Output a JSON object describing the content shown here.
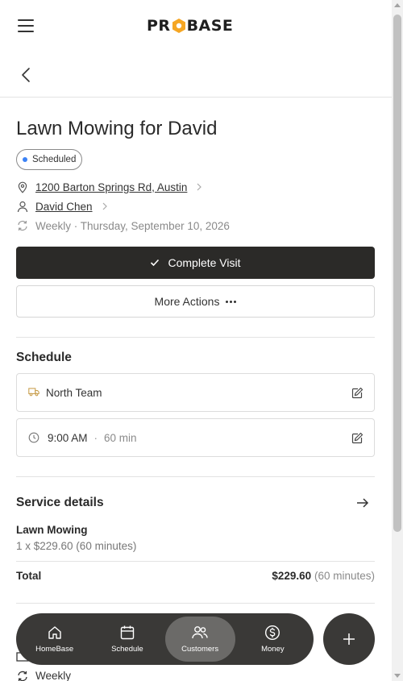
{
  "header": {
    "logo_text_left": "PR",
    "logo_text_right": "BASE",
    "menu_icon": "hamburger-icon"
  },
  "nav": {
    "back_icon": "chevron-left-icon"
  },
  "visit": {
    "title": "Lawn Mowing for David",
    "status": "Scheduled",
    "status_color": "#3b82f6",
    "address": "1200 Barton Springs Rd, Austin",
    "customer": "David Chen",
    "recurrence": "Weekly · Thursday, September 10, 2026"
  },
  "actions": {
    "complete_label": "Complete Visit",
    "more_label": "More Actions"
  },
  "schedule": {
    "heading": "Schedule",
    "team": "North Team",
    "time": "9:00 AM",
    "duration": "60 min"
  },
  "service": {
    "heading": "Service details",
    "item_name": "Lawn Mowing",
    "item_detail": "1 x $229.60 (60 minutes)",
    "total_label": "Total",
    "total_amount": "$229.60",
    "total_duration": "(60 minutes)"
  },
  "peek": {
    "recurrence_label": "Weekly"
  },
  "bottom_nav": {
    "items": [
      {
        "label": "HomeBase",
        "icon": "home-icon"
      },
      {
        "label": "Schedule",
        "icon": "calendar-icon"
      },
      {
        "label": "Customers",
        "icon": "users-icon"
      },
      {
        "label": "Money",
        "icon": "dollar-icon"
      }
    ],
    "active": "Customers",
    "fab_icon": "plus-icon"
  },
  "colors": {
    "primary_button": "#2b2a28",
    "nav_bg": "#3a3937",
    "nav_active": "#6b6a68",
    "logo_accent": "#f5a623"
  }
}
